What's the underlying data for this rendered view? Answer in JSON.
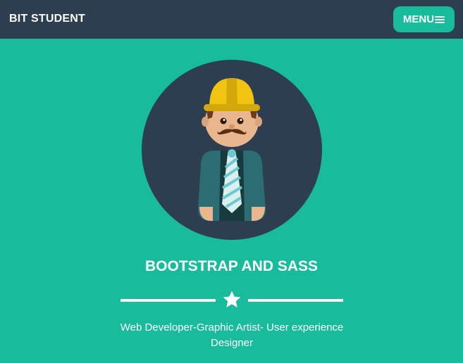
{
  "navbar": {
    "brand": "BIT STUDENT",
    "menu_label": "MENU",
    "menu_icon": "bars-icon"
  },
  "hero": {
    "avatar_icon": "developer-avatar-icon",
    "title": "BOOTSTRAP AND SASS",
    "divider_icon": "star-icon",
    "subtitle": "Web Developer-Graphic Artist- User experience Designer"
  },
  "colors": {
    "primary": "#18bc9c",
    "navbar": "#2c3e50",
    "text": "#ffffff",
    "hat": "#f1c40f"
  }
}
